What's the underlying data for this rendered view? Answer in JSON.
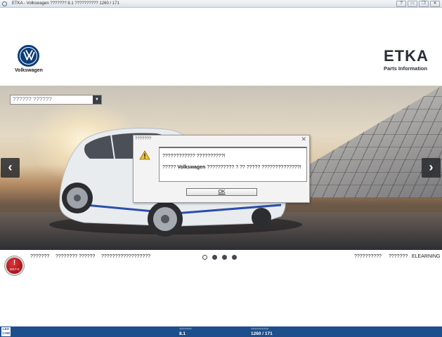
{
  "window": {
    "title": "ETKA - Volkswagen ??????? 8.1 ?????????? 1260 / 171",
    "buttons": {
      "help": "?",
      "minimize": "▭",
      "restore": "❐",
      "close": "✕"
    }
  },
  "header": {
    "brand_name": "Volkswagen",
    "product_logo": "ETKA",
    "product_subtitle": "Parts Information"
  },
  "banner": {
    "market_select_value": "?????? ??????",
    "prev_icon": "chevron-left-icon",
    "next_icon": "chevron-right-icon"
  },
  "dialog": {
    "title": "???????",
    "close_glyph": "✕",
    "icon": "warning-icon",
    "line1": "???????????? ??????????!",
    "line2_prefix": "????? ",
    "line2_brand": "Volkswagen",
    "line2_suffix": " ?????????? ? ?? ????? ??????????????!",
    "ok_label": "OK"
  },
  "footer": {
    "alert_code": "2017-0",
    "alert_glyph": "!",
    "links_left": [
      "???????",
      "???????? ??????",
      "??????????????????"
    ],
    "links_right": [
      "??????????",
      "???????",
      "ELEARNING"
    ],
    "carousel": {
      "total": 4,
      "active_index": 0
    }
  },
  "statusbar": {
    "lex_label": "LEX COM",
    "version_label": "???????",
    "version_value": "8.1",
    "data_label": "??????????",
    "data_value": "1260 / 171"
  }
}
